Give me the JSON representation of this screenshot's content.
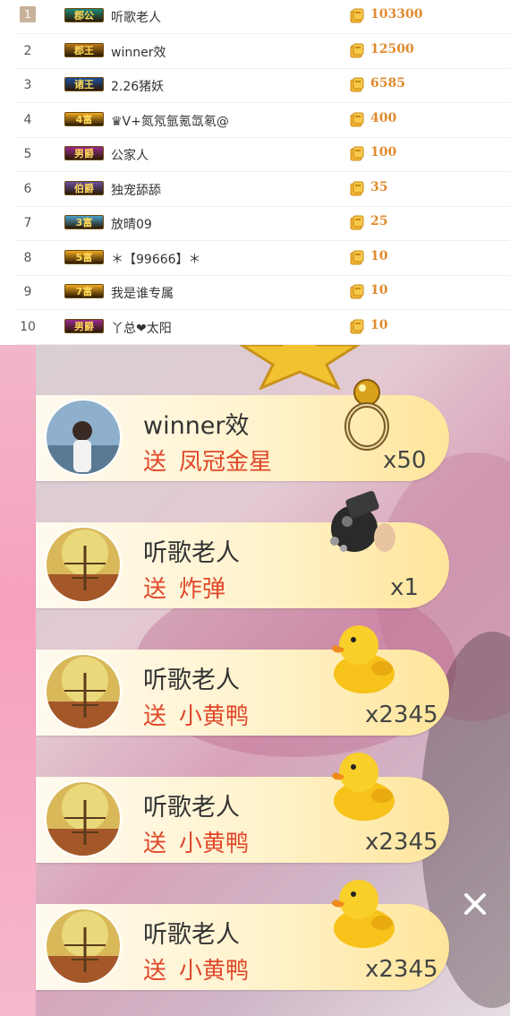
{
  "ranking": [
    {
      "rank": "1",
      "badge": "郡公",
      "badge_color": "#1f8a7a",
      "name": "听歌老人",
      "value": "103300"
    },
    {
      "rank": "2",
      "badge": "郡王",
      "badge_color": "#b6781c",
      "name": "winner效",
      "value": "12500"
    },
    {
      "rank": "3",
      "badge": "诸王",
      "badge_color": "#1c4f9a",
      "name": "2.26猪妖",
      "value": "6585"
    },
    {
      "rank": "4",
      "badge": "4富",
      "badge_color": "#f0a820",
      "name": "♛V+氮氖氩氪氙氡@",
      "value": "400"
    },
    {
      "rank": "5",
      "badge": "男爵",
      "badge_color": "#9a2a8a",
      "name": "公家人",
      "value": "100"
    },
    {
      "rank": "6",
      "badge": "伯爵",
      "badge_color": "#6a4fa0",
      "name": "独宠舔舔",
      "value": "35"
    },
    {
      "rank": "7",
      "badge": "3富",
      "badge_color": "#4aa0c8",
      "name": "放晴09",
      "value": "25"
    },
    {
      "rank": "8",
      "badge": "5富",
      "badge_color": "#f0a820",
      "name": "＊【99666】＊",
      "value": "10"
    },
    {
      "rank": "9",
      "badge": "7富",
      "badge_color": "#f0a820",
      "name": "我是谁专属",
      "value": "10"
    },
    {
      "rank": "10",
      "badge": "男爵",
      "badge_color": "#9a2a8a",
      "name": "丫总❤太阳",
      "value": "10"
    }
  ],
  "gifts": [
    {
      "user": "winner效",
      "send": "送",
      "gift": "凤冠金星",
      "count": "x50",
      "icon": "ring-icon",
      "avatar": "avatar-photo"
    },
    {
      "user": "听歌老人",
      "send": "送",
      "gift": "炸弹",
      "count": "x1",
      "icon": "bomb-icon",
      "avatar": "avatar-tree"
    },
    {
      "user": "听歌老人",
      "send": "送",
      "gift": "小黄鸭",
      "count": "x2345",
      "icon": "duck-icon",
      "avatar": "avatar-tree"
    },
    {
      "user": "听歌老人",
      "send": "送",
      "gift": "小黄鸭",
      "count": "x2345",
      "icon": "duck-icon",
      "avatar": "avatar-tree"
    },
    {
      "user": "听歌老人",
      "send": "送",
      "gift": "小黄鸭",
      "count": "x2345",
      "icon": "duck-icon",
      "avatar": "avatar-tree"
    }
  ],
  "colors": {
    "coin": "#f2b632",
    "value": "#e08a2e",
    "gift_text": "#e0472a",
    "pink_bar": "#f7a0bd"
  }
}
